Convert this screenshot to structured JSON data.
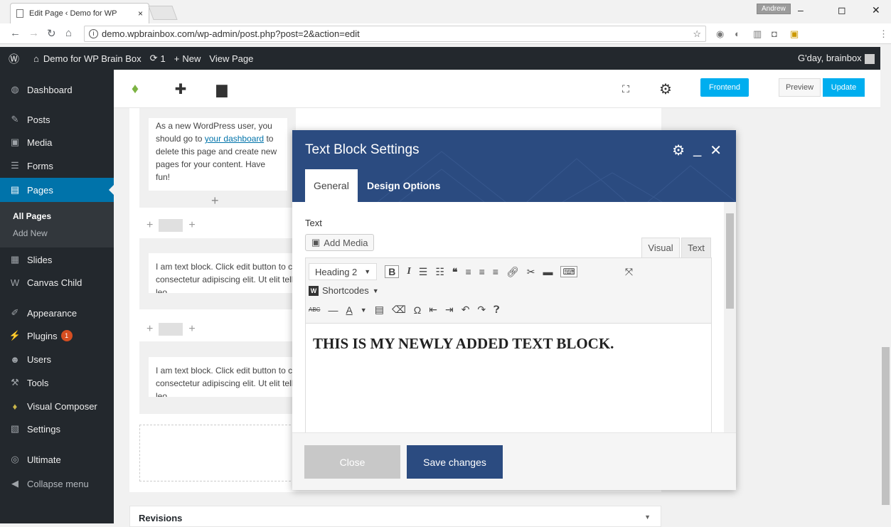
{
  "browser": {
    "tab_title": "Edit Page ‹ Demo for WP",
    "tab_close": "×",
    "profile": "Andrew",
    "minimize": "–",
    "restore": "◻",
    "close": "✕",
    "url": "demo.wpbrainbox.com/wp-admin/post.php?post=2&action=edit"
  },
  "adminbar": {
    "site_name": "Demo for WP Brain Box",
    "updates_count": "1",
    "new_label": "New",
    "view_page": "View Page",
    "greeting": "G'day, brainbox"
  },
  "sidebar": {
    "items": [
      {
        "label": "Dashboard",
        "icon": "dashboard-icon",
        "glyph": "◍"
      },
      {
        "label": "Posts",
        "icon": "pin-icon",
        "glyph": "✎"
      },
      {
        "label": "Media",
        "icon": "media-icon",
        "glyph": "▣"
      },
      {
        "label": "Forms",
        "icon": "forms-icon",
        "glyph": "☰"
      },
      {
        "label": "Pages",
        "icon": "pages-icon",
        "glyph": "▤"
      },
      {
        "label": "Slides",
        "icon": "slides-icon",
        "glyph": "▦"
      },
      {
        "label": "Canvas Child",
        "icon": "canvas-icon",
        "glyph": "W"
      },
      {
        "label": "Appearance",
        "icon": "brush-icon",
        "glyph": "✐"
      },
      {
        "label": "Plugins",
        "icon": "plugin-icon",
        "glyph": "⚡"
      },
      {
        "label": "Users",
        "icon": "users-icon",
        "glyph": "☻"
      },
      {
        "label": "Tools",
        "icon": "wrench-icon",
        "glyph": "⚒"
      },
      {
        "label": "Visual Composer",
        "icon": "vc-icon",
        "glyph": "♦"
      },
      {
        "label": "Settings",
        "icon": "settings-icon",
        "glyph": "▧"
      },
      {
        "label": "Ultimate",
        "icon": "ultimate-icon",
        "glyph": "◎"
      },
      {
        "label": "Collapse menu",
        "icon": "collapse-icon",
        "glyph": "◀"
      }
    ],
    "plugins_badge": "1",
    "sub_all_pages": "All Pages",
    "sub_add_new": "Add New"
  },
  "toolbar": {
    "frontend": "Frontend",
    "preview": "Preview",
    "update": "Update"
  },
  "builder": {
    "card1_text_a": "As a new WordPress user, you should go to ",
    "card1_link": "your dashboard",
    "card1_text_b": " to delete this page and create new pages for your content. Have fun!",
    "card2_text": "I am text block. Click edit button to change this text. Lorem ipsum dolor sit amet, consectetur adipiscing elit. Ut elit tellus, luctus nec ullamcorper mattis, pulvinar dapibus leo.",
    "card3_text": "I am text block. Click edit button to change this text. Lorem ipsum dolor sit amet, consectetur adipiscing elit. Ut elit tellus, luctus nec ullamcorper mattis, pulvinar dapibus leo.",
    "revisions": "Revisions"
  },
  "modal": {
    "title": "Text Block Settings",
    "tabs": [
      "General",
      "Design Options"
    ],
    "field_label": "Text",
    "add_media": "Add Media",
    "editor_tabs": [
      "Visual",
      "Text"
    ],
    "format": "Heading 2",
    "shortcodes": "Shortcodes",
    "content": "THIS IS MY NEWLY ADDED TEXT BLOCK.",
    "close": "Close",
    "save": "Save changes"
  }
}
